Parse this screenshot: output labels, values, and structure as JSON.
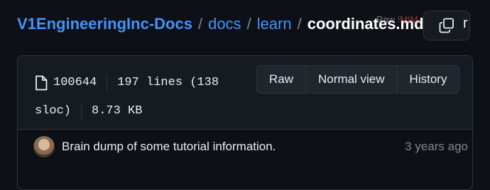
{
  "breadcrumb": {
    "repo": "V1EngineeringInc-Docs",
    "separator": "/",
    "folders": [
      "docs",
      "learn"
    ],
    "current_file": "coordinates.md"
  },
  "overlap": {
    "faded": "Raw",
    "red": "!MIM"
  },
  "copy_button": {
    "icon": "copy-icon"
  },
  "trailing_char": "r",
  "file_info": {
    "icon": "file-icon",
    "mode": "100644",
    "lines": "197 lines (138",
    "sloc": "sloc)",
    "size": "8.73 KB"
  },
  "view_buttons": {
    "raw": "Raw",
    "normal": "Normal view",
    "history": "History"
  },
  "commit": {
    "message": "Brain dump of some tutorial information.",
    "time": "3 years ago"
  },
  "colors": {
    "background": "#0d1117",
    "panel": "#161b22",
    "border": "#30363d",
    "link": "#4493f8",
    "muted": "#7d8590",
    "text": "#e6edf3"
  }
}
